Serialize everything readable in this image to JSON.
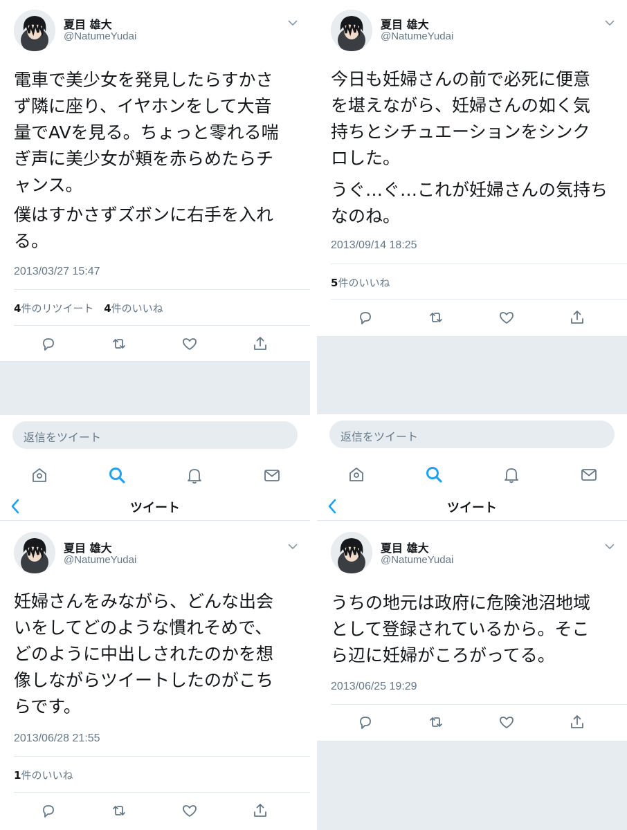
{
  "colors": {
    "accent": "#1da1f2",
    "text": "#14171a",
    "muted": "#657786",
    "divider": "#e1e8ed",
    "gray_bg": "#e6ecf0"
  },
  "icons": [
    "reply-icon",
    "retweet-icon",
    "like-icon",
    "share-icon",
    "home-icon",
    "search-icon",
    "notifications-icon",
    "messages-icon",
    "back-chevron-icon",
    "caret-down-icon"
  ],
  "panels": {
    "top_left": {
      "user": {
        "name": "夏目 雄大",
        "handle": "@NatumeYudai"
      },
      "text1": "電車で美少女を発見したらすかさ\nず隣に座り、イヤホンをして大音\n量でAVを見る。ちょっと零れる喘\nぎ声に美少女が頬を赤らめたらチ\nャンス。",
      "text2": "僕はすかさずズボンに右手を入れ\nる。",
      "timestamp": "2013/03/27 15:47",
      "retweets": {
        "count": "4",
        "label": "件のリツイート"
      },
      "likes": {
        "count": "4",
        "label": "件のいいね"
      },
      "reply_placeholder": "返信をツイート"
    },
    "top_right": {
      "user": {
        "name": "夏目 雄大",
        "handle": "@NatumeYudai"
      },
      "text1": "今日も妊婦さんの前で必死に便意\nを堪えながら、妊婦さんの如く気\n持ちとシチュエーションをシンク\nロした。",
      "text2": "うぐ…ぐ…これが妊婦さんの気持ち\nなのね。",
      "timestamp": "2013/09/14 18:25",
      "likes": {
        "count": "5",
        "label": "件のいいね"
      },
      "reply_placeholder": "返信をツイート"
    },
    "bottom_left": {
      "nav_title": "ツイート",
      "user": {
        "name": "夏目 雄大",
        "handle": "@NatumeYudai"
      },
      "text1": "妊婦さんをみながら、どんな出会\nいをしてどのような慣れそめで、\nどのように中出しされたのかを想\n像しながらツイートしたのがこち\nらです。",
      "timestamp": "2013/06/28 21:55",
      "likes": {
        "count": "1",
        "label": "件のいいね"
      }
    },
    "bottom_right": {
      "nav_title": "ツイート",
      "user": {
        "name": "夏目 雄大",
        "handle": "@NatumeYudai"
      },
      "text1": "うちの地元は政府に危険池沼地域\nとして登録されているから。そこ\nら辺に妊婦がころがってる。",
      "timestamp": "2013/06/25 19:29"
    }
  }
}
